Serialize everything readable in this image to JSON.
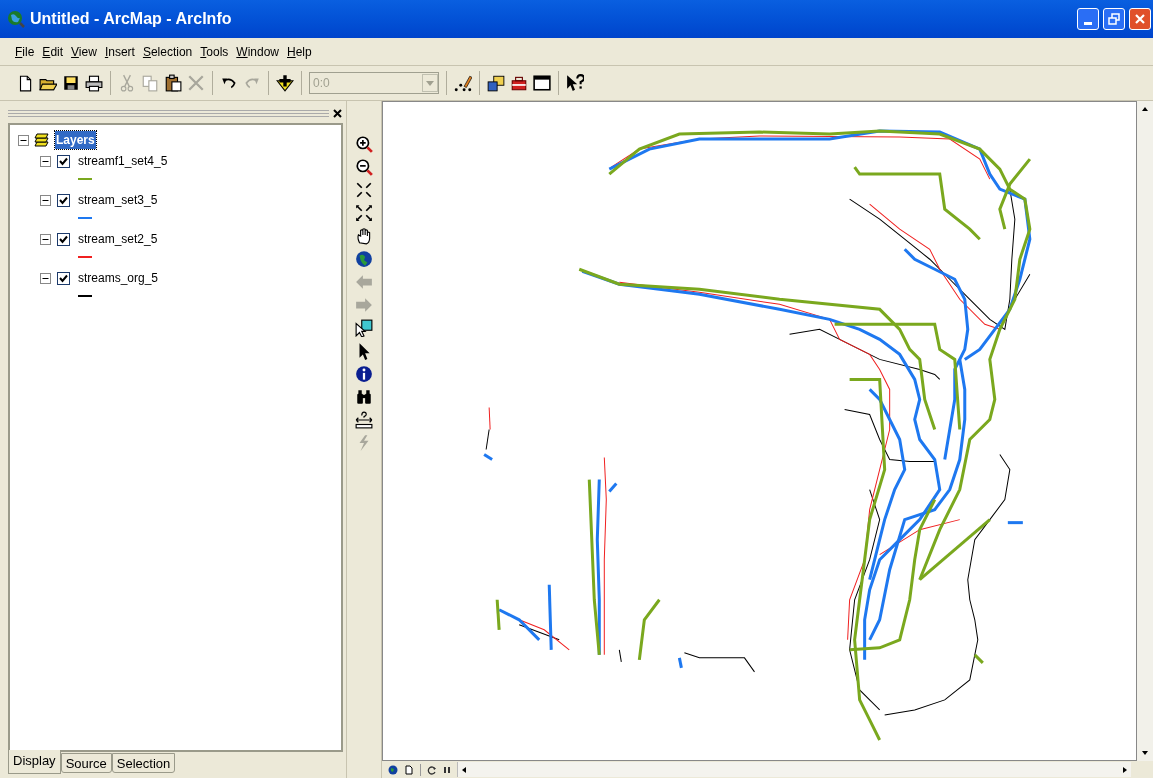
{
  "window": {
    "title": "Untitled - ArcMap - ArcInfo"
  },
  "menu": [
    "File",
    "Edit",
    "View",
    "Insert",
    "Selection",
    "Tools",
    "Window",
    "Help"
  ],
  "toolbar": [
    {
      "kind": "new",
      "disabled": false
    },
    {
      "kind": "open",
      "disabled": false
    },
    {
      "kind": "save",
      "disabled": false
    },
    {
      "kind": "print",
      "disabled": false
    },
    {
      "kind": "sep"
    },
    {
      "kind": "cut",
      "disabled": true
    },
    {
      "kind": "copy",
      "disabled": true
    },
    {
      "kind": "paste",
      "disabled": false
    },
    {
      "kind": "delete",
      "disabled": true
    },
    {
      "kind": "sep"
    },
    {
      "kind": "undo",
      "disabled": false
    },
    {
      "kind": "redo",
      "disabled": true
    },
    {
      "kind": "sep"
    },
    {
      "kind": "add",
      "disabled": false
    },
    {
      "kind": "sep"
    },
    {
      "kind": "scale"
    },
    {
      "kind": "sep"
    },
    {
      "kind": "editor",
      "disabled": false
    },
    {
      "kind": "sep"
    },
    {
      "kind": "catalog",
      "disabled": false
    },
    {
      "kind": "toolbox",
      "disabled": false
    },
    {
      "kind": "command",
      "disabled": false
    },
    {
      "kind": "sep"
    },
    {
      "kind": "help",
      "disabled": false
    }
  ],
  "scale_box": {
    "value": "0:0",
    "disabled": true
  },
  "toc": {
    "root": {
      "label": "Layers",
      "selected": true,
      "expanded": true
    },
    "layers": [
      {
        "name": "streamf1_set4_5",
        "checked": true,
        "expanded": true,
        "color": "#7aa81e"
      },
      {
        "name": "stream_set3_5",
        "checked": true,
        "expanded": true,
        "color": "#1e78f0"
      },
      {
        "name": "stream_set2_5",
        "checked": true,
        "expanded": true,
        "color": "#f02020"
      },
      {
        "name": "streams_org_5",
        "checked": true,
        "expanded": true,
        "color": "#000000"
      }
    ]
  },
  "toc_tabs": [
    {
      "label": "Display",
      "selected": true
    },
    {
      "label": "Source",
      "selected": false
    },
    {
      "label": "Selection",
      "selected": false
    }
  ],
  "tools": [
    {
      "kind": "zoomin",
      "disabled": false
    },
    {
      "kind": "zoomout",
      "disabled": false
    },
    {
      "kind": "fixedin",
      "disabled": false
    },
    {
      "kind": "fixedout",
      "disabled": false
    },
    {
      "kind": "pan",
      "disabled": false
    },
    {
      "kind": "full",
      "disabled": false
    },
    {
      "kind": "back",
      "disabled": true
    },
    {
      "kind": "forward",
      "disabled": true
    },
    {
      "kind": "selectfeatures",
      "disabled": false
    },
    {
      "kind": "pointer",
      "disabled": false
    },
    {
      "kind": "identify",
      "disabled": false
    },
    {
      "kind": "find",
      "disabled": false
    },
    {
      "kind": "measure",
      "disabled": false
    },
    {
      "kind": "hyperlink",
      "disabled": true
    }
  ]
}
